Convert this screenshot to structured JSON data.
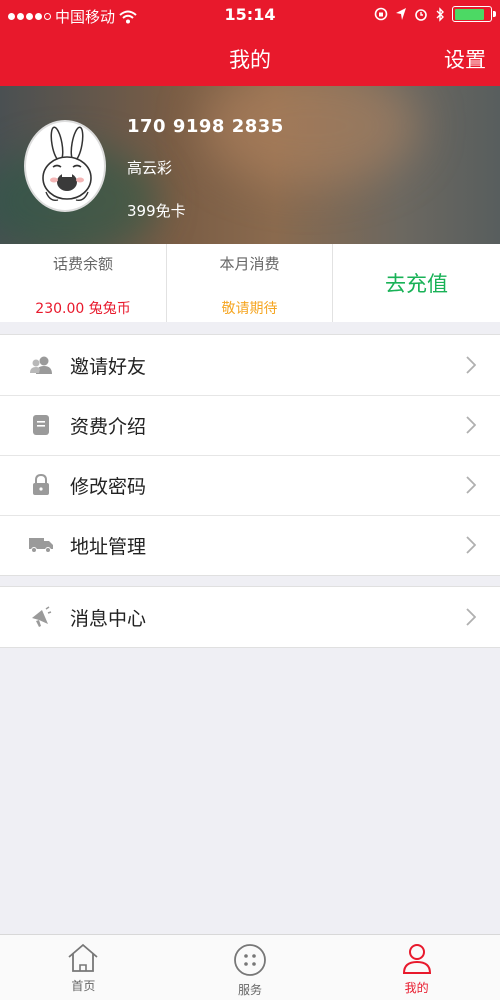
{
  "status_bar": {
    "carrier": "中国移动",
    "time": "15:14",
    "signal_bars": 4,
    "battery_level": 0.85
  },
  "nav": {
    "title": "我的",
    "settings_label": "设置"
  },
  "profile": {
    "phone": "170 9198 2835",
    "name": "高云彩",
    "card": "399免卡"
  },
  "stats": [
    {
      "label": "话费余额",
      "value": "230.00 兔兔币"
    },
    {
      "label": "本月消费",
      "value": "敬请期待"
    }
  ],
  "recharge_label": "去充值",
  "menu": [
    {
      "label": "邀请好友",
      "icon": "users-icon"
    },
    {
      "label": "资费介绍",
      "icon": "document-icon"
    },
    {
      "label": "修改密码",
      "icon": "lock-icon"
    },
    {
      "label": "地址管理",
      "icon": "truck-icon"
    }
  ],
  "menu2": [
    {
      "label": "消息中心",
      "icon": "megaphone-icon"
    }
  ],
  "tabs": [
    {
      "label": "首页",
      "icon": "home-icon"
    },
    {
      "label": "服务",
      "icon": "service-icon"
    },
    {
      "label": "我的",
      "icon": "person-icon",
      "active": true
    }
  ],
  "colors": {
    "brand_red": "#e8192c",
    "recharge_green": "#19b257",
    "pending_orange": "#f5a623"
  }
}
